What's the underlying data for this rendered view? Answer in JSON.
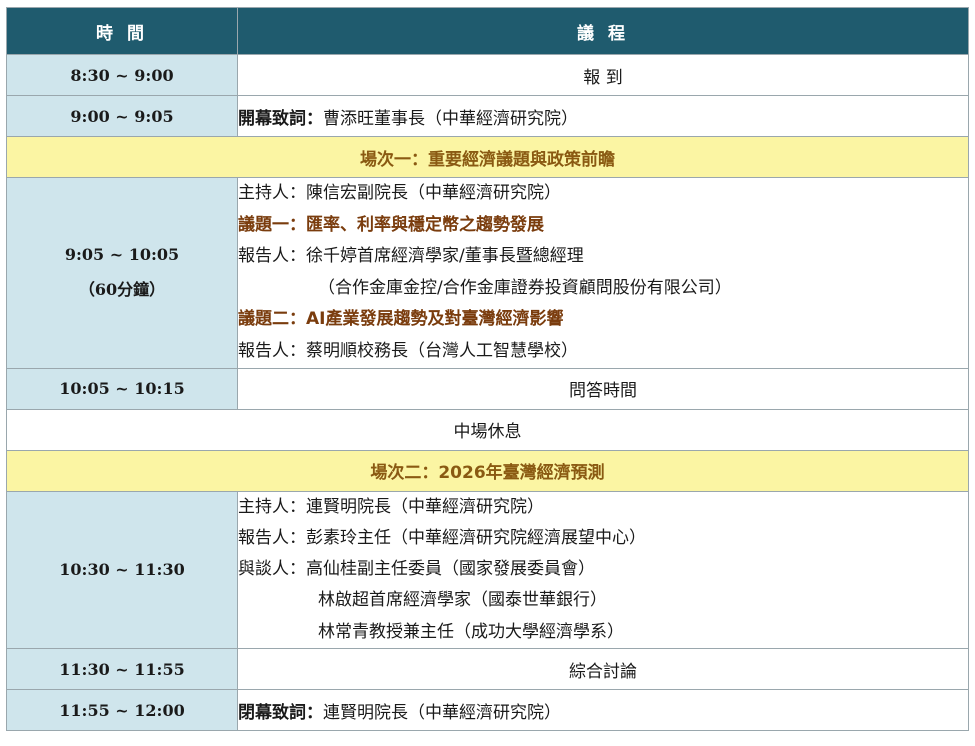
{
  "header": {
    "time": "時 間",
    "program": "議 程"
  },
  "rows": {
    "r1": {
      "time": "8:30 ~ 9:00",
      "program": "報 到"
    },
    "r2": {
      "time": "9:00 ~ 9:05",
      "label": "開幕致詞：",
      "program": "曹添旺董事長（中華經濟研究院）"
    },
    "session1": "場次一：重要經濟議題與政策前瞻",
    "s1": {
      "time": "9:05 ~ 10:05",
      "duration": "（60分鐘）",
      "host": "主持人：陳信宏副院長（中華經濟研究院）",
      "topic1": "議題一：匯率、利率與穩定幣之趨勢發展",
      "speaker1": "報告人：徐千婷首席經濟學家/董事長暨總經理",
      "speaker1_org": "（合作金庫金控/合作金庫證券投資顧問股份有限公司）",
      "topic2": "議題二：AI產業發展趨勢及對臺灣經濟影響",
      "speaker2": "報告人：蔡明順校務長（台灣人工智慧學校）"
    },
    "qa": {
      "time": "10:05 ~ 10:15",
      "program": "問答時間"
    },
    "break": "中場休息",
    "session2": "場次二：2026年臺灣經濟預測",
    "s2": {
      "time": "10:30 ~ 11:30",
      "host": "主持人：連賢明院長（中華經濟研究院）",
      "speaker": "報告人：彭素玲主任（中華經濟研究院經濟展望中心）",
      "panel1": "與談人：高仙桂副主任委員（國家發展委員會）",
      "panel2": "林啟超首席經濟學家（國泰世華銀行）",
      "panel3": "林常青教授兼主任（成功大學經濟學系）"
    },
    "discussion": {
      "time": "11:30 ~ 11:55",
      "program": "綜合討論"
    },
    "closing": {
      "time": "11:55 ~ 12:00",
      "label": "閉幕致詞：",
      "program": "連賢明院長（中華經濟研究院）"
    }
  },
  "colors": {
    "header_bg": "#1f5b6e",
    "time_bg": "#cfe5ec",
    "session_bg": "#fbf5a3",
    "topic_text": "#7a3c0d"
  }
}
